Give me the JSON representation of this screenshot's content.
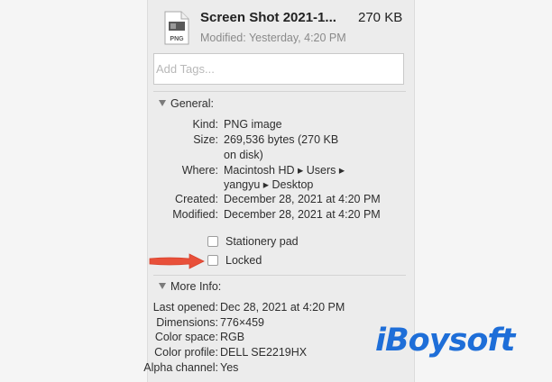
{
  "file": {
    "name": "Screen Shot 2021-1...",
    "size": "270 KB",
    "modified": "Modified: Yesterday, 4:20 PM",
    "icon_label": "PNG"
  },
  "tags": {
    "placeholder": "Add Tags..."
  },
  "general": {
    "header": "General:",
    "rows": [
      {
        "label": "Kind:",
        "value": "PNG image"
      },
      {
        "label": "Size:",
        "value": "269,536 bytes (270 KB",
        "value2": "on disk)"
      },
      {
        "label": "Where:",
        "value": "Macintosh HD ▸ Users ▸",
        "value2": "yangyu ▸ Desktop"
      },
      {
        "label": "Created:",
        "value": "December 28, 2021 at 4:20 PM"
      },
      {
        "label": "Modified:",
        "value": "December 28, 2021 at 4:20 PM"
      }
    ],
    "stationery_label": "Stationery pad",
    "locked_label": "Locked"
  },
  "more_info": {
    "header": "More Info:",
    "rows": [
      {
        "label": "Last opened:",
        "value": "Dec 28, 2021 at 4:20 PM"
      },
      {
        "label": "Dimensions:",
        "value": "776×459"
      },
      {
        "label": "Color space:",
        "value": "RGB"
      },
      {
        "label": "Color profile:",
        "value": "DELL SE2219HX"
      },
      {
        "label": "Alpha channel:",
        "value": "Yes"
      }
    ]
  },
  "watermark": "iBoysoft",
  "colors": {
    "arrow": "#e8503a",
    "watermark": "#1e6ed8",
    "panel": "#ececec"
  }
}
